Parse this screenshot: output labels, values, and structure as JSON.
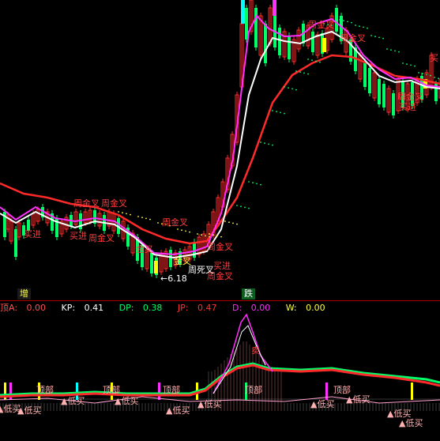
{
  "colors": {
    "background": "#000000",
    "up": "#ff2a2a",
    "down": "#00ff66",
    "cyan": "#00ffff",
    "magenta": "#ff30ff",
    "yellow": "#ffff00",
    "white": "#ffffff",
    "separator": "#b00000"
  },
  "main_chart": {
    "low_price_label": "←6.18",
    "tags": {
      "increase_label": "增",
      "fall_label": "跌"
    },
    "signals": {
      "top_right_buy": "买",
      "buy_in_1": "买进",
      "buy_in_2": "买进",
      "buy_in_3": "买进",
      "buy_in_4": "买进",
      "golden_cross_1": "周金叉",
      "golden_cross_2": "周金叉",
      "golden_cross_3": "周金叉",
      "golden_cross_4": "周金叉",
      "golden_cross_5": "周金叉",
      "golden_cross_6": "周金叉",
      "golden_cross_7": "周金叉",
      "golden_cross_8": "周金叉",
      "golden_cross_9": "周金叉",
      "dead_cross": "周死叉",
      "buy_gold_cross": "金叉",
      "stay_label": "金叉"
    }
  },
  "indicator": {
    "fields": [
      {
        "name": "顶A:",
        "value": "0.00",
        "color": "#ff5050"
      },
      {
        "name": "KP:",
        "value": "0.41",
        "color": "#ffffff"
      },
      {
        "name": "DP:",
        "value": "0.38",
        "color": "#00ff66"
      },
      {
        "name": "JP:",
        "value": "0.47",
        "color": "#ff3030"
      },
      {
        "name": "D:",
        "value": "0.00",
        "color": "#ff30ff"
      },
      {
        "name": "W:",
        "value": "0.00",
        "color": "#ffff40"
      }
    ],
    "labels": {
      "top_1": "顶部",
      "top_2": "顶部",
      "top_3": "顶部",
      "top_4": "顶部",
      "top_5": "顶部",
      "buy_low_1": "▲低买",
      "buy_low_2": "▲低买",
      "buy_low_3": "▲低买",
      "buy_low_4": "▲低买",
      "buy_low_5": "▲低买",
      "buy_low_6": "▲低买",
      "buy_low_7": "▲低买",
      "buy_low_8": "▲低买",
      "buy_low_9": "▲低买",
      "buy_low_10": "▲低买",
      "peak_label": "卖"
    }
  }
}
